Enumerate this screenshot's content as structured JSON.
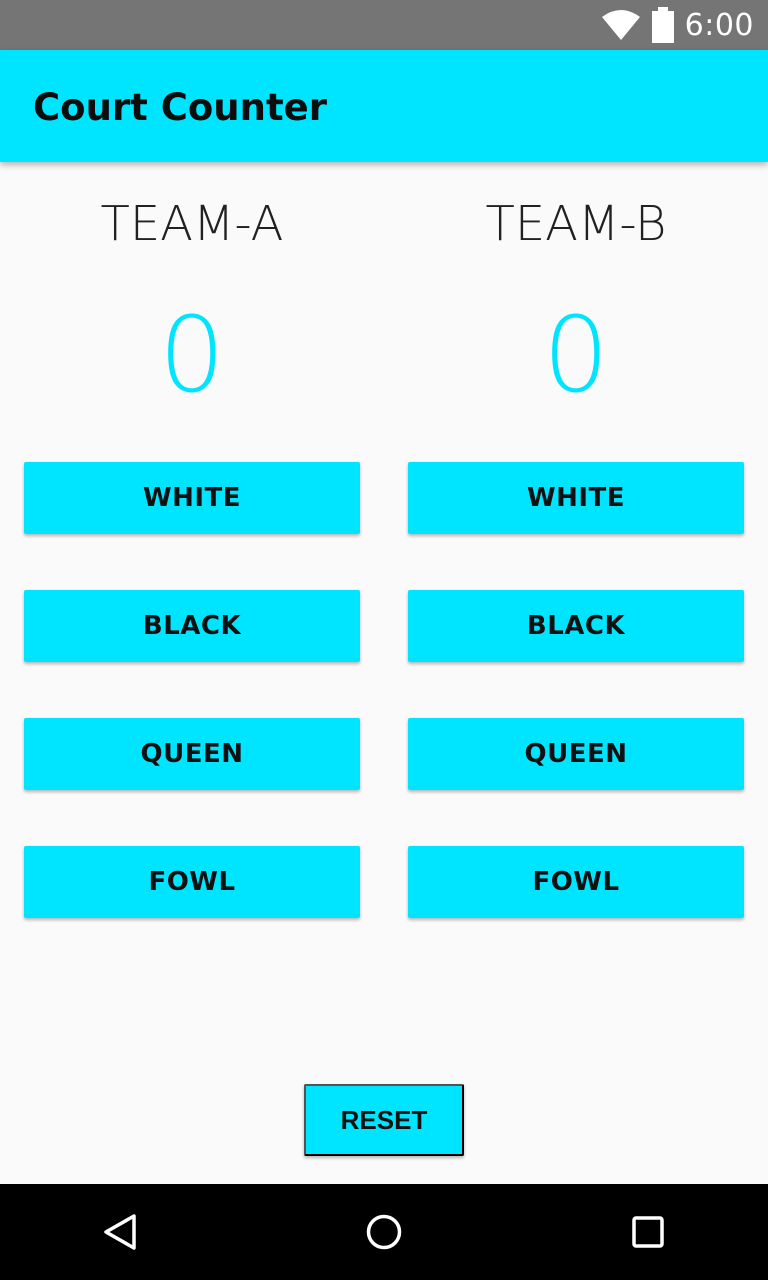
{
  "status_bar": {
    "time": "6:00",
    "icons": [
      "wifi-icon",
      "battery-icon"
    ]
  },
  "app_bar": {
    "title": "Court Counter"
  },
  "teams": [
    {
      "name": "TEAM-A",
      "score": "0",
      "buttons": [
        "WHITE",
        "BLACK",
        "QUEEN",
        "FOWL"
      ]
    },
    {
      "name": "TEAM-B",
      "score": "0",
      "buttons": [
        "WHITE",
        "BLACK",
        "QUEEN",
        "FOWL"
      ]
    }
  ],
  "reset_label": "RESET",
  "nav_bar": {
    "icons": [
      "back-icon",
      "home-icon",
      "recents-icon"
    ]
  },
  "colors": {
    "accent": "#00e5ff",
    "status_bar": "#757575",
    "nav_bar": "#000000",
    "background": "#fafafa"
  }
}
